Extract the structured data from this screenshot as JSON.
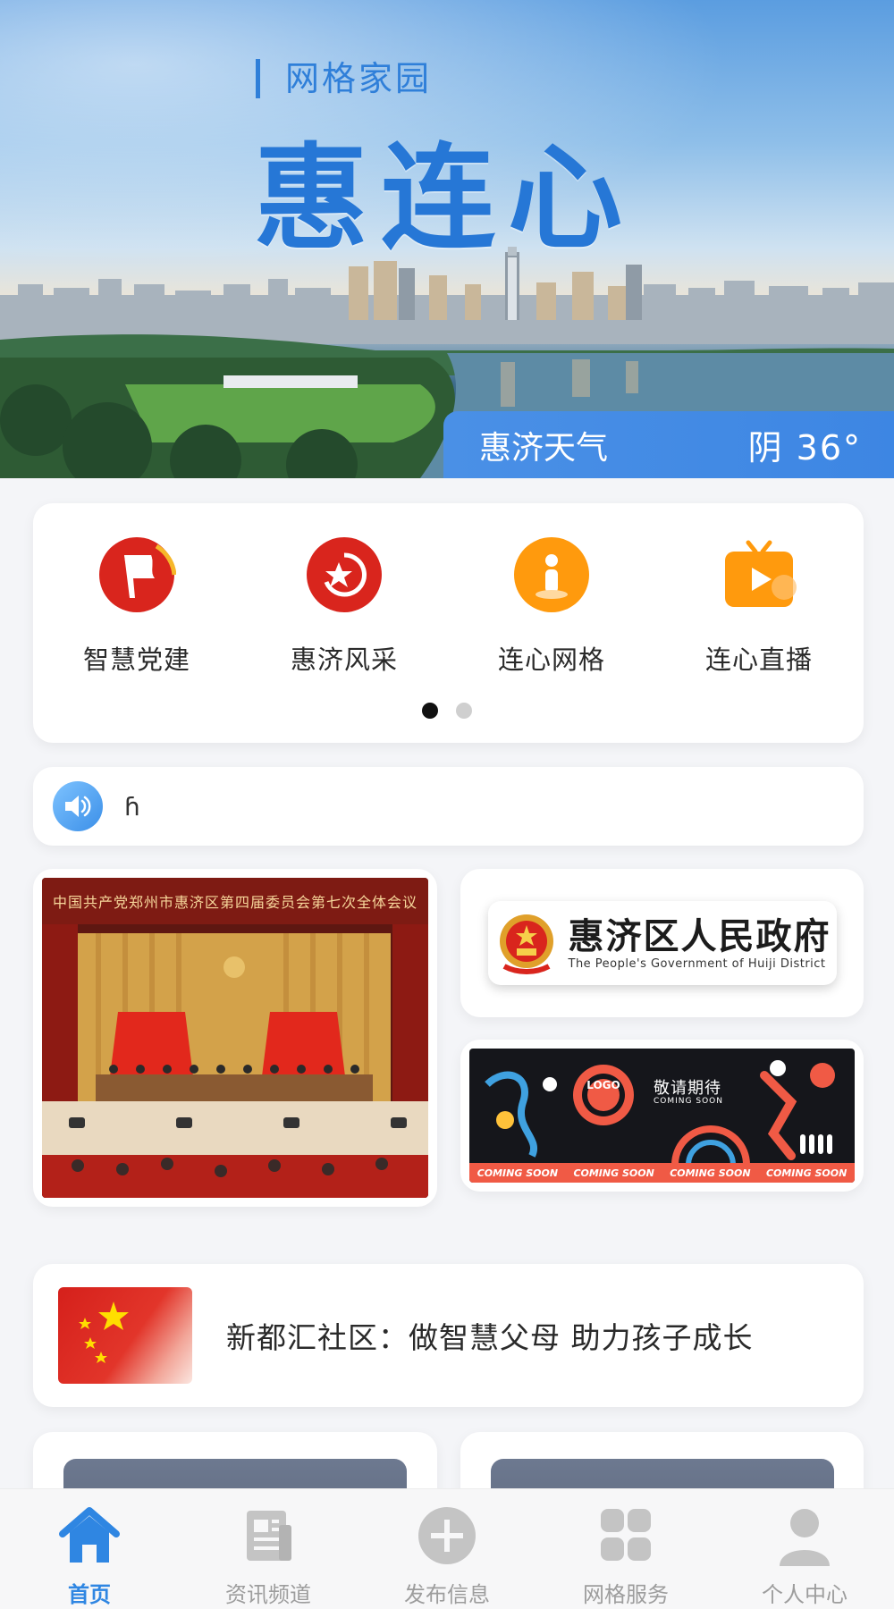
{
  "banner": {
    "subtitle": "网格家园",
    "title": "惠连心",
    "weather_label": "惠济天气",
    "weather_value": "阴 36°"
  },
  "menu": {
    "items": [
      {
        "label": "智慧党建",
        "icon": "party-flag-icon"
      },
      {
        "label": "惠济风采",
        "icon": "star-emblem-icon"
      },
      {
        "label": "连心网格",
        "icon": "person-pin-icon"
      },
      {
        "label": "连心直播",
        "icon": "tv-play-icon"
      }
    ],
    "page_count": 2,
    "active_page": 1
  },
  "notice": {
    "text": "ɦ"
  },
  "tiles": {
    "meeting_banner": "中国共产党郑州市惠济区第四届委员会第七次全体会议",
    "gov_name": "惠济区人民政府",
    "gov_en": "The People's Government of Huiji District",
    "soon_title": "敬请期待",
    "soon_sub": "COMING SOON",
    "soon_logo": "LOGO",
    "soon_strip": [
      "COMING SOON",
      "COMING SOON",
      "COMING SOON",
      "COMING SOON"
    ]
  },
  "news": {
    "title": "新都汇社区：做智慧父母 助力孩子成长"
  },
  "tabbar": {
    "tabs": [
      {
        "label": "首页",
        "icon": "home-icon",
        "active": true
      },
      {
        "label": "资讯频道",
        "icon": "news-icon",
        "active": false
      },
      {
        "label": "发布信息",
        "icon": "plus-circle-icon",
        "active": false
      },
      {
        "label": "网格服务",
        "icon": "grid-icon",
        "active": false
      },
      {
        "label": "个人中心",
        "icon": "user-icon",
        "active": false
      }
    ]
  },
  "colors": {
    "brand_blue": "#2f86e2",
    "party_red": "#d9251d",
    "orange": "#ff9a0d"
  }
}
